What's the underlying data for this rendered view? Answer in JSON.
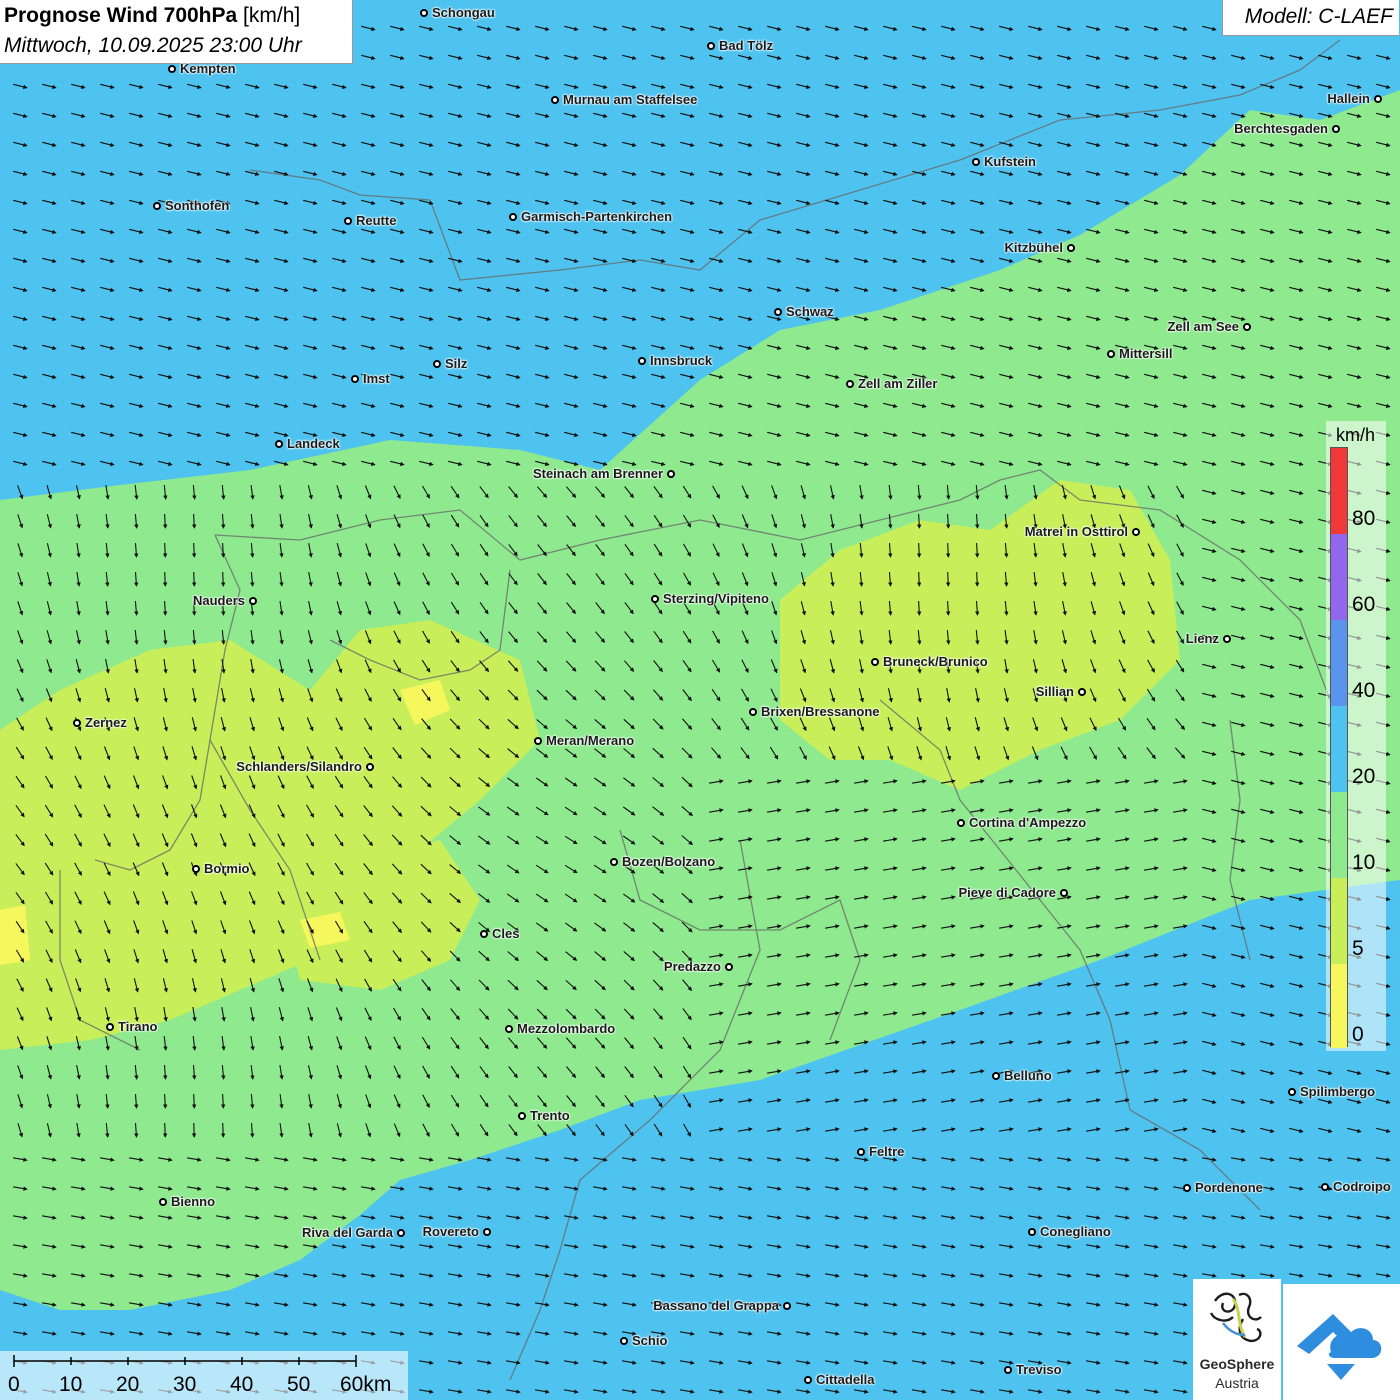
{
  "header": {
    "title_bold": "Prognose Wind 700hPa",
    "title_unit": "[km/h]",
    "datetime": "Mittwoch, 10.09.2025 23:00 Uhr",
    "model": "Modell: C-LAEF"
  },
  "colors": {
    "wind_0_5": "#f6f75c",
    "wind_5_10": "#c8ef5a",
    "wind_10_20": "#8ee98f",
    "wind_20_40": "#4fc3ef",
    "wind_40_60": "#5a94ec",
    "wind_60_80": "#9367ec",
    "wind_80_plus": "#f0383b"
  },
  "legend": {
    "unit": "km/h",
    "labels": [
      "80",
      "60",
      "40",
      "20",
      "10",
      "5",
      "0"
    ]
  },
  "scale": {
    "labels": [
      "0",
      "10",
      "20",
      "30",
      "40",
      "50",
      "60km"
    ]
  },
  "logo": {
    "line1": "GeoSphere",
    "line2": "Austria"
  },
  "cities": [
    {
      "name": "Schongau"
    },
    {
      "name": "Bad Tölz"
    },
    {
      "name": "Kempten"
    },
    {
      "name": "Murnau am Staffelsee"
    },
    {
      "name": "Hallein"
    },
    {
      "name": "Berchtesgaden"
    },
    {
      "name": "Kufstein"
    },
    {
      "name": "Sonthofen"
    },
    {
      "name": "Reutte"
    },
    {
      "name": "Garmisch-Partenkirchen"
    },
    {
      "name": "Kitzbühel"
    },
    {
      "name": "Schwaz"
    },
    {
      "name": "Zell am See"
    },
    {
      "name": "Mittersill"
    },
    {
      "name": "Silz"
    },
    {
      "name": "Innsbruck"
    },
    {
      "name": "Imst"
    },
    {
      "name": "Zell am Ziller"
    },
    {
      "name": "Landeck"
    },
    {
      "name": "Steinach am Brenner"
    },
    {
      "name": "Matrei in Osttirol"
    },
    {
      "name": "Nauders"
    },
    {
      "name": "Sterzing/Vipiteno"
    },
    {
      "name": "Lienz"
    },
    {
      "name": "Bruneck/Brunico"
    },
    {
      "name": "Sillian"
    },
    {
      "name": "Brixen/Bressanone"
    },
    {
      "name": "Zernez"
    },
    {
      "name": "Meran/Merano"
    },
    {
      "name": "Schlanders/Silandro"
    },
    {
      "name": "Cortina d'Ampezzo"
    },
    {
      "name": "Bozen/Bolzano"
    },
    {
      "name": "Bormio"
    },
    {
      "name": "Pieve di Cadore"
    },
    {
      "name": "Cles"
    },
    {
      "name": "Predazzo"
    },
    {
      "name": "Tirano"
    },
    {
      "name": "Mezzolombardo"
    },
    {
      "name": "Belluno"
    },
    {
      "name": "Spilimbergo"
    },
    {
      "name": "Trento"
    },
    {
      "name": "Feltre"
    },
    {
      "name": "Pordenone"
    },
    {
      "name": "Codroipo"
    },
    {
      "name": "Bienno"
    },
    {
      "name": "Riva del Garda"
    },
    {
      "name": "Rovereto"
    },
    {
      "name": "Conegliano"
    },
    {
      "name": "Bassano del Grappa"
    },
    {
      "name": "Schio"
    },
    {
      "name": "Treviso"
    },
    {
      "name": "Cittadella"
    }
  ]
}
